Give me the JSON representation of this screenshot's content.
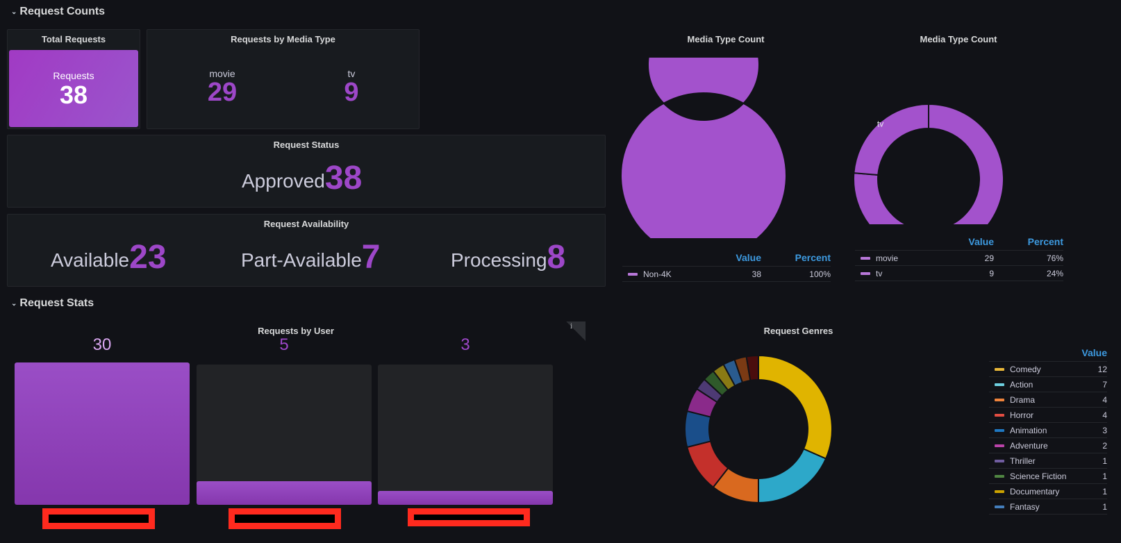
{
  "rows": {
    "counts_title": "Request Counts",
    "stats_title": "Request Stats"
  },
  "total_requests": {
    "title": "Total Requests",
    "label": "Requests",
    "value": "38"
  },
  "requests_by_media_type": {
    "title": "Requests by Media Type",
    "items": [
      {
        "label": "movie",
        "value": "29"
      },
      {
        "label": "tv",
        "value": "9"
      }
    ]
  },
  "request_status": {
    "title": "Request Status",
    "items": [
      {
        "label": "Approved",
        "value": "38"
      }
    ]
  },
  "request_availability": {
    "title": "Request Availability",
    "items": [
      {
        "label": "Available",
        "value": "23"
      },
      {
        "label": "Part-Available",
        "value": "7"
      },
      {
        "label": "Processing",
        "value": "8"
      }
    ]
  },
  "requests_by_user": {
    "title": "Requests by User",
    "info_icon": "i",
    "max": 30,
    "bars": [
      {
        "value": 30,
        "value_label": "30",
        "label": "[redacted]"
      },
      {
        "value": 5,
        "value_label": "5",
        "label": "[redacted]"
      },
      {
        "value": 3,
        "value_label": "3",
        "label": "[redacted]"
      }
    ]
  },
  "legend_headers": {
    "value": "Value",
    "percent": "Percent"
  },
  "colors": {
    "purple": "#9d47c8",
    "accent_blue": "#3d9ae0",
    "redact_red": "#ff2a1e"
  },
  "chart_data": [
    {
      "type": "pie",
      "title": "Media Type Count",
      "donut": true,
      "slices": [
        {
          "label": "Non-4K",
          "value": 38,
          "percent": "100%",
          "color": "#a352cc"
        }
      ],
      "slice_labels_visible": [
        "Non-4K"
      ],
      "legend": "bottom-table"
    },
    {
      "type": "pie",
      "title": "Media Type Count",
      "donut": true,
      "slices": [
        {
          "label": "movie",
          "value": 29,
          "percent": "76%",
          "color": "#a352cc"
        },
        {
          "label": "tv",
          "value": 9,
          "percent": "24%",
          "color": "#a352cc"
        }
      ],
      "legend": "bottom-table"
    },
    {
      "type": "pie",
      "title": "Request Genres",
      "donut": true,
      "legend": "right-table",
      "slices": [
        {
          "label": "Comedy",
          "value": 12,
          "color": "#e0b400",
          "swatch": "#eab839"
        },
        {
          "label": "Action",
          "value": 7,
          "color": "#2da8c9",
          "swatch": "#6ed0e0"
        },
        {
          "label": "Drama",
          "value": 4,
          "color": "#d9691f",
          "swatch": "#ef843c"
        },
        {
          "label": "Horror",
          "value": 4,
          "color": "#c4302b",
          "swatch": "#e24d42"
        },
        {
          "label": "Animation",
          "value": 3,
          "color": "#1a4e8a",
          "swatch": "#1f78c1"
        },
        {
          "label": "Adventure",
          "value": 2,
          "color": "#8a2a8a",
          "swatch": "#ba43a9"
        },
        {
          "label": "Thriller",
          "value": 1,
          "color": "#4d3a74",
          "swatch": "#705da0"
        },
        {
          "label": "Science Fiction",
          "value": 1,
          "color": "#2f5a2a",
          "swatch": "#508642"
        },
        {
          "label": "Documentary",
          "value": 1,
          "color": "#8a7a14",
          "swatch": "#cca300"
        },
        {
          "label": "Fantasy",
          "value": 1,
          "color": "#2a5b8f",
          "swatch": "#447ebc"
        },
        {
          "label": "",
          "value": 1,
          "color": "#7a3a14",
          "swatch": null
        },
        {
          "label": "",
          "value": 1,
          "color": "#4a0d0d",
          "swatch": null
        }
      ]
    }
  ]
}
